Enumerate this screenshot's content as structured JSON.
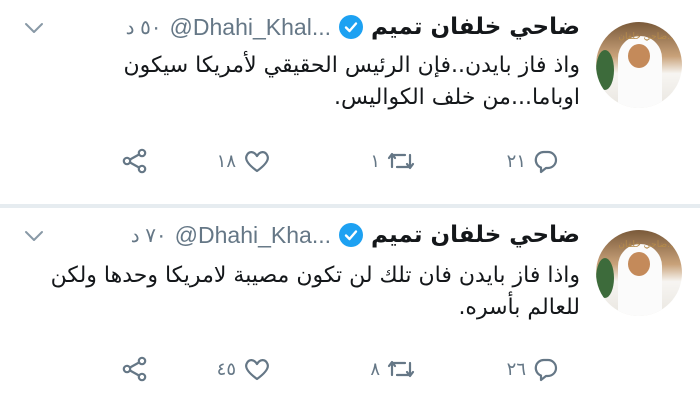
{
  "tweets": [
    {
      "name": "ضاحي خلفان تميم",
      "handle": "@Dhahi_Khal...",
      "time": "٥٠ د",
      "text": "واذ فاز بايدن..فإن الرئيس الحقيقي لأمريكا  سيكون اوباما...من خلف الكواليس.",
      "replies": "٢١",
      "retweets": "١",
      "likes": "١٨",
      "avatar_logo": "د.ضاحي خلفان"
    },
    {
      "name": "ضاحي خلفان تميم",
      "handle": "@Dhahi_Kha...",
      "time": "٧٠ د",
      "text": "واذا فاز بايدن فان تلك لن تكون مصيبة لامريكا وحدها ولكن للعالم بأسره.",
      "replies": "٢٦",
      "retweets": "٨",
      "likes": "٤٥",
      "avatar_logo": "د.ضاحي خلفان"
    }
  ],
  "colors": {
    "primary_text": "#14171a",
    "secondary_text": "#657786",
    "verified_blue": "#1da1f2",
    "divider": "#e6ecf0"
  },
  "icons": {
    "verified": "verified-badge-icon",
    "caret": "chevron-down-icon",
    "reply": "reply-icon",
    "retweet": "retweet-icon",
    "like": "heart-icon",
    "share": "share-icon"
  }
}
